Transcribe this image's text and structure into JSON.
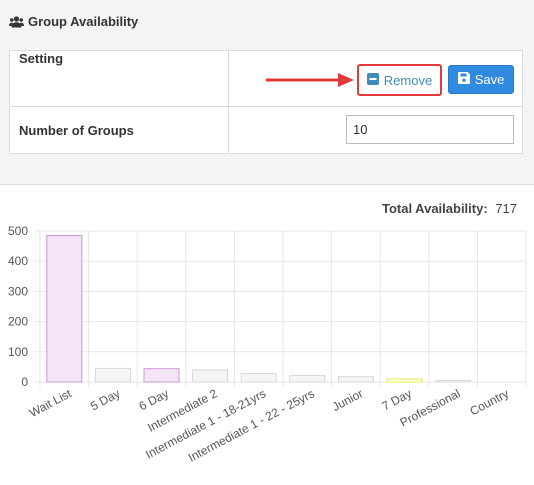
{
  "panel": {
    "title": "Group Availability",
    "title_icon": "users-icon"
  },
  "settings": {
    "setting_label": "Setting",
    "remove_label": "Remove",
    "save_label": "Save",
    "groups_label": "Number of Groups",
    "groups_value": "10"
  },
  "summary": {
    "total_label": "Total Availability:",
    "total_value": "717"
  },
  "colors": {
    "save_button": "#2f8ae0",
    "highlight_box": "#e03a3a",
    "arrow": "#e03a3a"
  },
  "chart_data": {
    "type": "bar",
    "categories": [
      "Wait List",
      "5 Day",
      "6 Day",
      "Intermediate 2",
      "Intermediate 1 - 18-21yrs",
      "Intermediate 1 - 22 - 25yrs",
      "Junior",
      "7 Day",
      "Professional",
      "Country"
    ],
    "values": [
      485,
      45,
      44,
      40,
      28,
      22,
      18,
      10,
      5,
      0
    ],
    "bar_fills": [
      "#f3e5f5",
      "#f5f5f5",
      "#f3e5f5",
      "#f5f5f5",
      "#f5f5f5",
      "#f5f5f5",
      "#f5f5f5",
      "#fffde7",
      "#f5f5f5",
      "#f5f5f5"
    ],
    "bar_strokes": [
      "#ce93d8",
      "#d8d8d8",
      "#ce93d8",
      "#d8d8d8",
      "#d8d8d8",
      "#d8d8d8",
      "#d8d8d8",
      "#e6ee50",
      "#d8d8d8",
      "#d8d8d8"
    ],
    "yticks": [
      "0",
      "100",
      "200",
      "300",
      "400",
      "500"
    ],
    "ylim": [
      0,
      500
    ],
    "grid": true,
    "title": "",
    "xlabel": "",
    "ylabel": ""
  }
}
